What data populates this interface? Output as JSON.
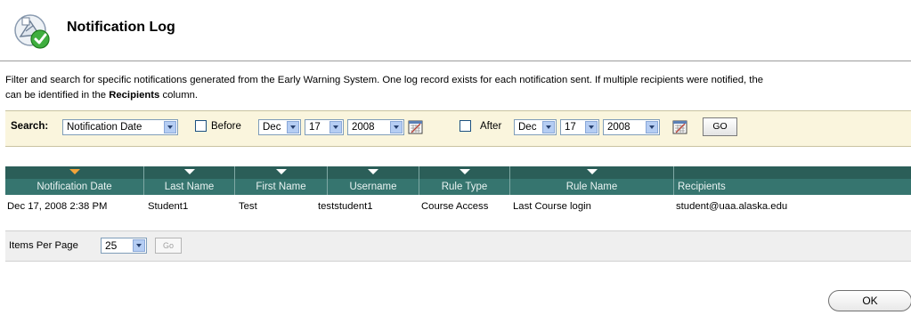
{
  "header": {
    "title": "Notification Log",
    "icon": "notification-check-icon"
  },
  "intro": {
    "line1": "Filter and search for specific notifications generated from the Early Warning System. One log record exists for each notification sent. If multiple recipients were notified, the",
    "line2_pre": "can be identified in the ",
    "line2_bold": "Recipients",
    "line2_post": " column."
  },
  "search": {
    "label": "Search:",
    "field": "Notification Date",
    "before_label": "Before",
    "before_month": "Dec",
    "before_day": "17",
    "before_year": "2008",
    "after_label": "After",
    "after_month": "Dec",
    "after_day": "17",
    "after_year": "2008",
    "go_label": "GO"
  },
  "table": {
    "columns": [
      "Notification Date",
      "Last Name",
      "First Name",
      "Username",
      "Rule Type",
      "Rule Name",
      "Recipients"
    ],
    "rows": [
      [
        "Dec 17, 2008 2:38 PM",
        "Student1",
        "Test",
        "teststudent1",
        "Course Access",
        "Last Course login",
        "student@uaa.alaska.edu"
      ]
    ]
  },
  "paging": {
    "label": "Items Per Page",
    "value": "25",
    "go_label": "Go"
  },
  "footer": {
    "ok_label": "OK"
  },
  "colors": {
    "header_bg": "#36756f",
    "search_bg": "#faf5dd",
    "sort_indicator": "#f3a43a"
  }
}
